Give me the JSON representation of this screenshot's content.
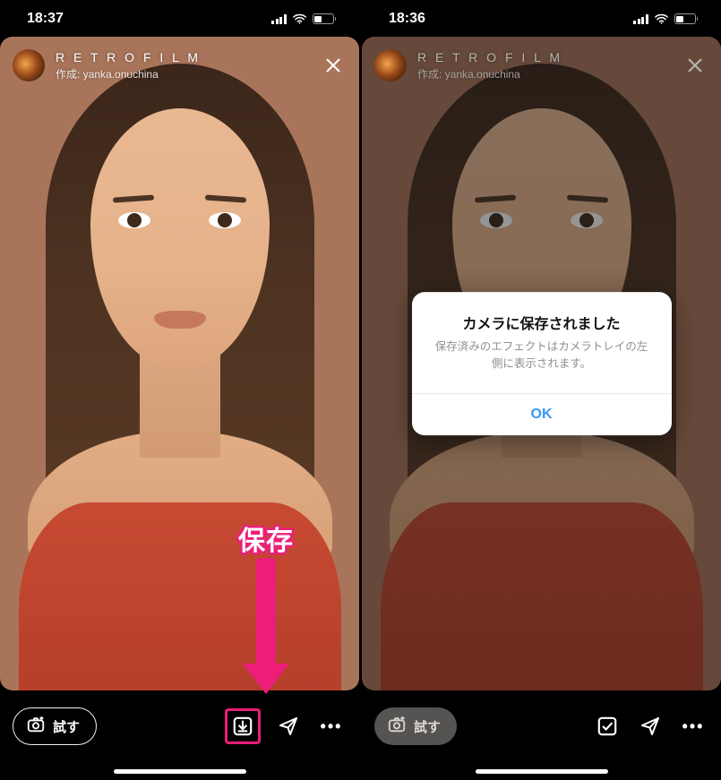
{
  "left": {
    "status": {
      "time": "18:37"
    },
    "effect": {
      "name": "R E T R O  F I L M",
      "author_prefix": "作成:",
      "author": "yanka.onuchina"
    },
    "annotation": {
      "label": "保存"
    },
    "bottom": {
      "try_label": "試す",
      "more": "•••"
    }
  },
  "right": {
    "status": {
      "time": "18:36"
    },
    "effect": {
      "name": "R E T R O  F I L M",
      "author_prefix": "作成:",
      "author": "yanka.onuchina"
    },
    "dialog": {
      "title": "カメラに保存されました",
      "message": "保存済みのエフェクトはカメラトレイの左側に表示されます。",
      "ok": "OK"
    },
    "bottom": {
      "try_label": "試す",
      "more": "•••"
    }
  },
  "colors": {
    "accent": "#ec1e79",
    "link": "#3897f0"
  }
}
